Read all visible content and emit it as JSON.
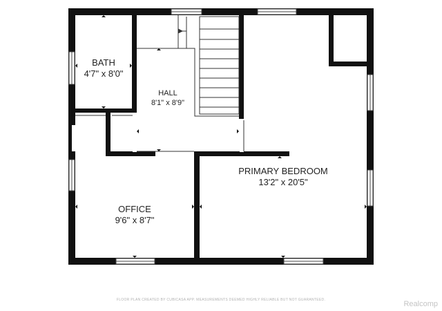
{
  "rooms": {
    "bath": {
      "name": "BATH",
      "dims": "4'7\" x 8'0\""
    },
    "hall": {
      "name": "HALL",
      "dims": "8'1\" x 8'9\""
    },
    "primary_bedroom": {
      "name": "PRIMARY BEDROOM",
      "dims": "13'2\" x 20'5\""
    },
    "office": {
      "name": "OFFICE",
      "dims": "9'6\" x 8'7\""
    }
  },
  "footer_note": "FLOOR PLAN CREATED BY CUBICASA APP. MEASUREMENTS DEEMED HIGHLY RELIABLE BUT NOT GUARANTEED.",
  "watermark": "Realcomp",
  "colors": {
    "wall": "#111111",
    "line": "#222222",
    "background": "#ffffff"
  }
}
